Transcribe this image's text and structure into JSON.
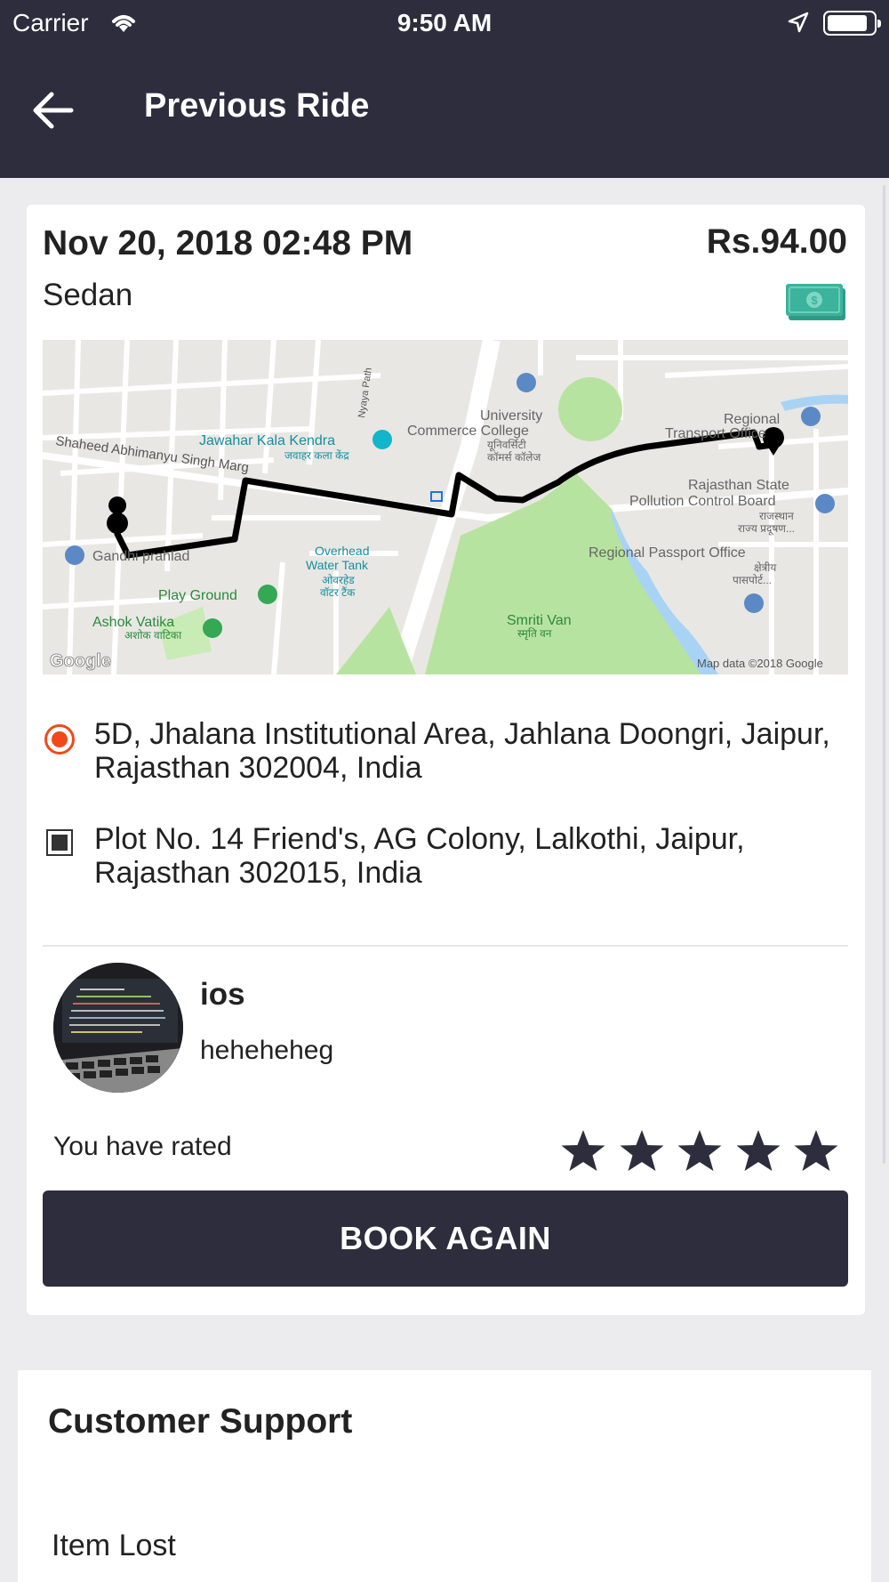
{
  "status_bar": {
    "carrier": "Carrier",
    "time": "9:50 AM"
  },
  "header": {
    "title": "Previous Ride",
    "back_icon": "arrow-left-icon"
  },
  "ride": {
    "date_time": "Nov 20, 2018 02:48 PM",
    "vehicle_type": "Sedan",
    "fare": "Rs.94.00",
    "payment_icon": "cash-icon",
    "pickup_address": "5D, Jhalana Institutional Area, Jahlana Doongri, Jaipur, Rajasthan 302004, India",
    "drop_address": "Plot No. 14 Friend's, AG Colony, Lalkothi, Jaipur, Rajasthan 302015, India"
  },
  "map": {
    "labels": {
      "jawahar": "Jawahar Kala Kendra",
      "jawahar_hi": "जवाहर कला केंद्र",
      "shaheed": "Shaheed Abhimanyu Singh Marg",
      "nyaya": "Nyaya Path",
      "university1": "University",
      "university2": "Commerce College",
      "university_hi1": "यूनिवर्सिटी",
      "university_hi2": "कॉमर्स कॉलेज",
      "regional_transport1": "Regional",
      "regional_transport2": "Transport Office",
      "rspcb1": "Rajasthan State",
      "rspcb2": "Pollution Control Board",
      "rspcb_hi1": "राजस्थान",
      "rspcb_hi2": "राज्य प्रदूषण...",
      "passport": "Regional Passport Office",
      "passport_hi1": "क्षेत्रीय",
      "passport_hi2": "पासपोर्ट...",
      "gandhi": "Gandhi prahlad",
      "overhead1": "Overhead",
      "overhead2": "Water Tank",
      "overhead_hi1": "ओवरहेड",
      "overhead_hi2": "वॉटर टैंक",
      "playground": "Play Ground",
      "ashok": "Ashok Vatika",
      "ashok_hi": "अशोक वाटिका",
      "smriti": "Smriti Van",
      "smriti_hi": "स्मृति वन",
      "google": "Google",
      "attribution": "Map data ©2018 Google"
    }
  },
  "driver": {
    "name": "ios",
    "vehicle": "heheheheg",
    "avatar_icon": "driver-avatar"
  },
  "rating": {
    "label": "You have rated",
    "value": 5,
    "max": 5
  },
  "book_again_label": "BOOK AGAIN",
  "support": {
    "title": "Customer Support",
    "items": [
      "Item Lost"
    ]
  },
  "colors": {
    "primary": "#2e2d3d",
    "pickup": "#f04a1a",
    "cash": "#3cb39c",
    "background": "#ececee"
  }
}
